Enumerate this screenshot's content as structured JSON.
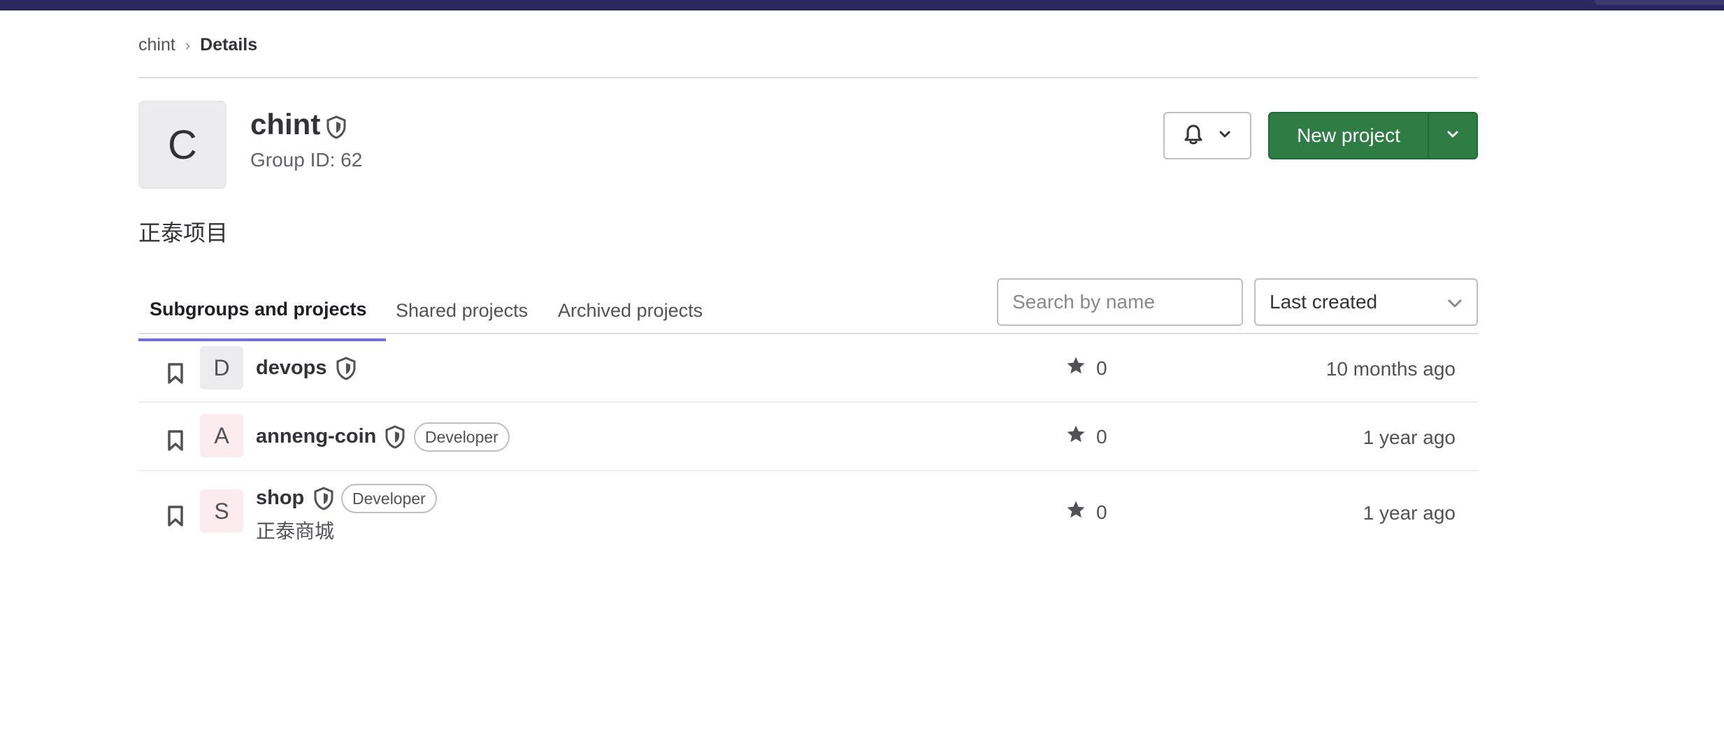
{
  "breadcrumb": {
    "parent": "chint",
    "separator": "›",
    "current": "Details"
  },
  "group": {
    "avatar_letter": "C",
    "name": "chint",
    "id_text": "Group ID: 62",
    "description": "正泰项目"
  },
  "actions": {
    "notification_icon": "bell-icon",
    "new_project_label": "New project"
  },
  "tabs": [
    {
      "label": "Subgroups and projects",
      "active": true
    },
    {
      "label": "Shared projects",
      "active": false
    },
    {
      "label": "Archived projects",
      "active": false
    }
  ],
  "search": {
    "placeholder": "Search by name",
    "value": ""
  },
  "sort": {
    "selected": "Last created"
  },
  "items": [
    {
      "avatar_letter": "D",
      "avatar_color": "#ececef",
      "name": "devops",
      "badge": "",
      "description": "",
      "stars": "0",
      "updated": "10 months ago"
    },
    {
      "avatar_letter": "A",
      "avatar_color": "#fcebee",
      "name": "anneng-coin",
      "badge": "Developer",
      "description": "",
      "stars": "0",
      "updated": "1 year ago"
    },
    {
      "avatar_letter": "S",
      "avatar_color": "#fcebee",
      "name": "shop",
      "badge": "Developer",
      "description": "正泰商城",
      "stars": "0",
      "updated": "1 year ago"
    }
  ],
  "colors": {
    "topbar": "#292961",
    "primary_button": "#2f7d44",
    "active_tab_underline": "#6e6fd6"
  }
}
